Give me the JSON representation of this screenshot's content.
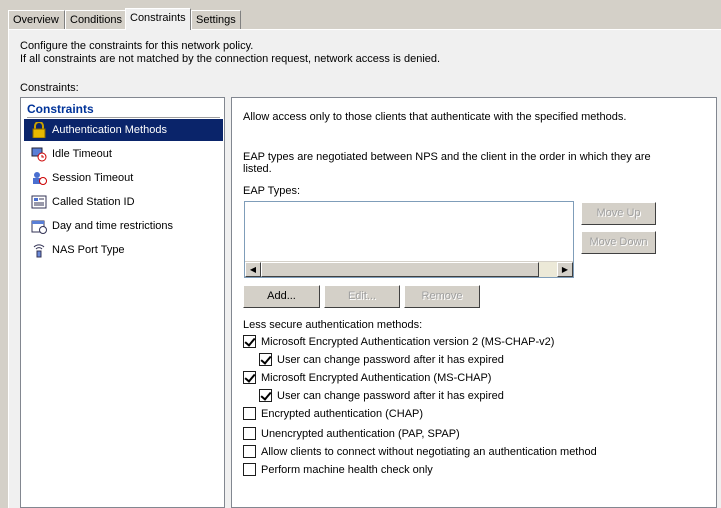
{
  "tabs": [
    {
      "label": "Overview"
    },
    {
      "label": "Conditions"
    },
    {
      "label": "Constraints"
    },
    {
      "label": "Settings"
    }
  ],
  "description": {
    "line1": "Configure the constraints for this network policy.",
    "line2": "If all constraints are not matched by the connection request, network access is denied."
  },
  "constraints_label": "Constraints:",
  "constraints_list": {
    "header": "Constraints",
    "items": [
      {
        "label": "Authentication Methods",
        "icon": "lock-icon",
        "selected": true
      },
      {
        "label": "Idle Timeout",
        "icon": "idle-timeout-icon"
      },
      {
        "label": "Session Timeout",
        "icon": "session-timeout-icon"
      },
      {
        "label": "Called Station ID",
        "icon": "station-id-icon"
      },
      {
        "label": "Day and time restrictions",
        "icon": "calendar-icon"
      },
      {
        "label": "NAS Port Type",
        "icon": "nas-port-icon"
      }
    ]
  },
  "auth_methods": {
    "intro": "Allow access only to those clients that authenticate with the specified methods.",
    "eap_note_line1": "EAP types are negotiated between NPS and the client in the order in which they are",
    "eap_note_line2": "listed.",
    "eap_types_label": "EAP Types:",
    "move_up": "Move Up",
    "move_down": "Move Down",
    "add": "Add...",
    "edit": "Edit...",
    "remove": "Remove",
    "less_secure_label": "Less secure authentication methods:",
    "options": [
      {
        "label": "Microsoft Encrypted Authentication version 2 (MS-CHAP-v2)",
        "checked": true
      },
      {
        "label": "User can change password after it has expired",
        "checked": true
      },
      {
        "label": "Microsoft Encrypted Authentication (MS-CHAP)",
        "checked": true
      },
      {
        "label": "User can change password after it has expired",
        "checked": true
      },
      {
        "label": "Encrypted authentication (CHAP)",
        "checked": false
      },
      {
        "label": "Unencrypted authentication (PAP, SPAP)",
        "checked": false
      },
      {
        "label": "Allow clients to connect without negotiating an authentication method",
        "checked": false
      },
      {
        "label": "Perform machine health check only",
        "checked": false
      }
    ]
  },
  "colors": {
    "selection": "#0a246a",
    "header_text": "#003399",
    "dialog_bg": "#d4d0c8"
  }
}
